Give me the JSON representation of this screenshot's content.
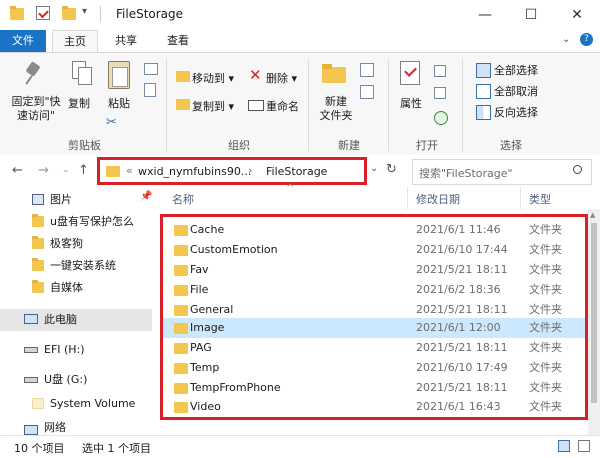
{
  "window": {
    "title": "FileStorage",
    "minimize": "—",
    "maximize": "☐",
    "close": "✕"
  },
  "ribbon_tabs": [
    "文件",
    "主页",
    "共享",
    "查看"
  ],
  "ribbon": {
    "clipboard": {
      "pin": "固定到\"快\n速访问\"",
      "copy": "复制",
      "paste": "粘贴",
      "group": "剪贴板"
    },
    "organize": {
      "move_to": "移动到",
      "copy_to": "复制到",
      "delete": "删除",
      "rename": "重命名",
      "group": "组织"
    },
    "new": {
      "new_folder": "新建\n文件夹",
      "group": "新建"
    },
    "open": {
      "properties": "属性",
      "group": "打开"
    },
    "select": {
      "select_all": "全部选择",
      "select_none": "全部取消",
      "invert": "反向选择",
      "group": "选择"
    }
  },
  "address": {
    "prefix": "«",
    "path1": "wxid_nymfubins90...",
    "sep": "›",
    "path2": "FileStorage",
    "refresh": "↻"
  },
  "search": {
    "placeholder": "搜索\"FileStorage\""
  },
  "nav_pane": [
    {
      "label": "图片",
      "icon": "pictures-icon"
    },
    {
      "label": "u盘有写保护怎么",
      "icon": "folder-icon"
    },
    {
      "label": "极客狗",
      "icon": "folder-icon"
    },
    {
      "label": "一键安装系统",
      "icon": "folder-icon"
    },
    {
      "label": "自媒体",
      "icon": "folder-icon"
    },
    {
      "label": "此电脑",
      "icon": "computer-icon"
    },
    {
      "label": "EFI (H:)",
      "icon": "drive-icon"
    },
    {
      "label": "U盘 (G:)",
      "icon": "usb-drive-icon"
    },
    {
      "label": "System Volume",
      "icon": "folder-icon"
    },
    {
      "label": "网络",
      "icon": "network-icon"
    }
  ],
  "columns": {
    "name": "名称",
    "date": "修改日期",
    "type": "类型"
  },
  "files": [
    {
      "name": "Cache",
      "date": "2021/6/1 11:46",
      "type": "文件夹"
    },
    {
      "name": "CustomEmotion",
      "date": "2021/6/10 17:44",
      "type": "文件夹"
    },
    {
      "name": "Fav",
      "date": "2021/5/21 18:11",
      "type": "文件夹"
    },
    {
      "name": "File",
      "date": "2021/6/2 18:36",
      "type": "文件夹"
    },
    {
      "name": "General",
      "date": "2021/5/21 18:11",
      "type": "文件夹"
    },
    {
      "name": "Image",
      "date": "2021/6/1 12:00",
      "type": "文件夹"
    },
    {
      "name": "PAG",
      "date": "2021/5/21 18:11",
      "type": "文件夹"
    },
    {
      "name": "Temp",
      "date": "2021/6/10 17:49",
      "type": "文件夹"
    },
    {
      "name": "TempFromPhone",
      "date": "2021/5/21 18:11",
      "type": "文件夹"
    },
    {
      "name": "Video",
      "date": "2021/6/1 16:43",
      "type": "文件夹"
    }
  ],
  "status": {
    "count": "10 个项目",
    "selected": "选中 1 个项目"
  },
  "colors": {
    "accent": "#1a73c5",
    "selection": "#cce8ff",
    "highlight": "#d62128",
    "folder": "#f3c74f"
  }
}
